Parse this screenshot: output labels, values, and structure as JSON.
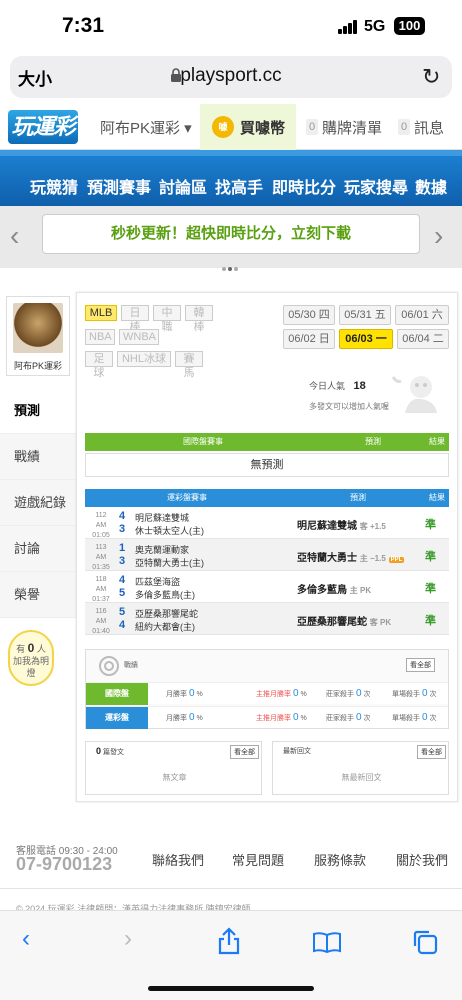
{
  "status": {
    "time": "7:31",
    "network": "5G",
    "battery": "100"
  },
  "browser": {
    "text_size": "大小",
    "url": "playsport.cc"
  },
  "topnav": {
    "logo": "玩運彩",
    "user": "阿布PK運彩 ▾",
    "coin_label": "買噱幣",
    "cart_count": "0",
    "cart_label": "購牌清單",
    "msg_count": "0",
    "msg_label": "訊息"
  },
  "mainnav": [
    "玩競猜",
    "預測賽事",
    "討論區",
    "找高手",
    "即時比分",
    "玩家搜尋",
    "數據"
  ],
  "banner": "秒秒更新！超快即時比分，立刻下載",
  "profile": {
    "name": "阿布PK運彩"
  },
  "sidebar": {
    "items": [
      "預測",
      "戰績",
      "遊戲紀錄",
      "討論",
      "榮譽"
    ],
    "bulb_line1": "有",
    "bulb_count": "0",
    "bulb_unit": "人",
    "bulb_line2": "加我為明燈"
  },
  "sports": [
    "MLB",
    "日棒",
    "中職",
    "韓棒",
    "NBA",
    "WNBA",
    "足球",
    "NHL冰球",
    "賽馬"
  ],
  "dates": [
    "05/30 四",
    "05/31 五",
    "06/01 六",
    "06/02 日",
    "06/03 一",
    "06/04 二"
  ],
  "popularity": {
    "label": "今日人氣",
    "value": "18"
  },
  "hint": "多發文可以增加人氣喔",
  "intl_table": {
    "headers": [
      "國際盤賽事",
      "預測",
      "結果"
    ],
    "empty": "無預測"
  },
  "lottery_table": {
    "headers": [
      "運彩盤賽事",
      "預測",
      "結果"
    ],
    "rows": [
      {
        "id": "112",
        "time": "AM 01:05",
        "away_score": "4",
        "away": "明尼蘇達雙城",
        "home_score": "3",
        "home": "休士頓太空人(主)",
        "pick": "明尼蘇達雙城",
        "line": "客 +1.5",
        "badge": "",
        "result": "準"
      },
      {
        "id": "113",
        "time": "AM 01:35",
        "away_score": "1",
        "away": "奧克蘭運動家",
        "home_score": "3",
        "home": "亞特蘭大勇士(主)",
        "pick": "亞特蘭大勇士",
        "line": "主 −1.5",
        "badge": "PPL",
        "result": "準"
      },
      {
        "id": "118",
        "time": "AM 01:37",
        "away_score": "4",
        "away": "匹茲堡海盜",
        "home_score": "5",
        "home": "多倫多藍鳥(主)",
        "pick": "多倫多藍鳥",
        "line": "主 PK",
        "badge": "",
        "result": "準"
      },
      {
        "id": "116",
        "time": "AM 01:40",
        "away_score": "5",
        "away": "亞歷桑那響尾蛇",
        "home_score": "4",
        "home": "紐約大都會(主)",
        "pick": "亞歷桑那響尾蛇",
        "line": "客 PK",
        "badge": "",
        "result": "準"
      }
    ]
  },
  "record": {
    "title": "戰績",
    "view_all": "看全部",
    "rows": [
      {
        "label": "國際盤",
        "month_label": "月勝率",
        "month_val": "0",
        "home_label": "主推月勝率",
        "home_val": "0",
        "ko_label": "莊家殺手",
        "ko_val": "0",
        "ko_unit": "次",
        "single_label": "單場殺手",
        "single_val": "0",
        "single_unit": "次"
      },
      {
        "label": "運彩盤",
        "month_label": "月勝率",
        "month_val": "0",
        "home_label": "主推月勝率",
        "home_val": "0",
        "ko_label": "莊家殺手",
        "ko_val": "0",
        "ko_unit": "次",
        "single_label": "單場殺手",
        "single_val": "0",
        "single_unit": "次"
      }
    ]
  },
  "posts": {
    "count": "0",
    "label": "篇發文",
    "view_all": "看全部",
    "empty": "無文章"
  },
  "replies": {
    "label": "最新回文",
    "view_all": "看全部",
    "empty": "無最新回文"
  },
  "footer": {
    "hours": "客服電話 09:30 - 24:00",
    "phone": "07-9700123",
    "links": [
      "聯絡我們",
      "常見問題",
      "服務條款",
      "關於我們"
    ],
    "copyright": "© 2024 玩運彩 法律顧問：漢英得力法律事務所 陳鎮宏律師"
  },
  "colors": {
    "intl_green": "#6fb92e",
    "lottery_blue": "#2a8fd8",
    "nav_blue": "#1b7fd0"
  }
}
